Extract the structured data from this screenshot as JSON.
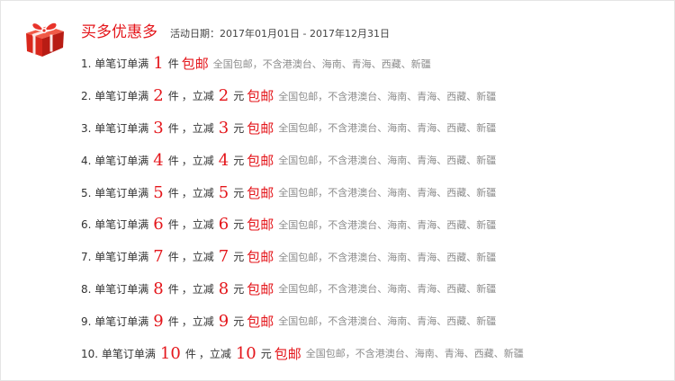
{
  "header": {
    "title": "买多优惠多",
    "date_label": "活动日期：2017年01月01日 - 2017年12月31日"
  },
  "icons": {
    "gift": "gift-box-icon"
  },
  "colors": {
    "accent": "#e4161b",
    "gift_red": "#e8332a",
    "note": "#8c8c8c"
  },
  "rows": [
    {
      "prefix": "1. 单笔订单满",
      "count": "1",
      "unit": "件",
      "has_discount": false,
      "free": "包邮",
      "note": "全国包邮，不含港澳台、海南、青海、西藏、新疆"
    },
    {
      "prefix": "2. 单笔订单满",
      "count": "2",
      "unit": "件",
      "has_discount": true,
      "discount_label": "，立减",
      "discount": "2",
      "discount_unit": "元",
      "free": "包邮",
      "note": "全国包邮，不含港澳台、海南、青海、西藏、新疆"
    },
    {
      "prefix": "3. 单笔订单满",
      "count": "3",
      "unit": "件",
      "has_discount": true,
      "discount_label": "，立减",
      "discount": "3",
      "discount_unit": "元",
      "free": "包邮",
      "note": "全国包邮，不含港澳台、海南、青海、西藏、新疆"
    },
    {
      "prefix": "4. 单笔订单满",
      "count": "4",
      "unit": "件",
      "has_discount": true,
      "discount_label": "，立减",
      "discount": "4",
      "discount_unit": "元",
      "free": "包邮",
      "note": "全国包邮，不含港澳台、海南、青海、西藏、新疆"
    },
    {
      "prefix": "5. 单笔订单满",
      "count": "5",
      "unit": "件",
      "has_discount": true,
      "discount_label": "，立减",
      "discount": "5",
      "discount_unit": "元",
      "free": "包邮",
      "note": "全国包邮，不含港澳台、海南、青海、西藏、新疆"
    },
    {
      "prefix": "6. 单笔订单满",
      "count": "6",
      "unit": "件",
      "has_discount": true,
      "discount_label": "，立减",
      "discount": "6",
      "discount_unit": "元",
      "free": "包邮",
      "note": "全国包邮，不含港澳台、海南、青海、西藏、新疆"
    },
    {
      "prefix": "7. 单笔订单满",
      "count": "7",
      "unit": "件",
      "has_discount": true,
      "discount_label": "，立减",
      "discount": "7",
      "discount_unit": "元",
      "free": "包邮",
      "note": "全国包邮，不含港澳台、海南、青海、西藏、新疆"
    },
    {
      "prefix": "8. 单笔订单满",
      "count": "8",
      "unit": "件",
      "has_discount": true,
      "discount_label": "，立减",
      "discount": "8",
      "discount_unit": "元",
      "free": "包邮",
      "note": "全国包邮，不含港澳台、海南、青海、西藏、新疆"
    },
    {
      "prefix": "9. 单笔订单满",
      "count": "9",
      "unit": "件",
      "has_discount": true,
      "discount_label": "，立减",
      "discount": "9",
      "discount_unit": "元",
      "free": "包邮",
      "note": "全国包邮，不含港澳台、海南、青海、西藏、新疆"
    },
    {
      "prefix": "10. 单笔订单满",
      "count": "10",
      "unit": "件",
      "has_discount": true,
      "discount_label": "，立减",
      "discount": "10",
      "discount_unit": "元",
      "free": "包邮",
      "note": "全国包邮，不含港澳台、海南、青海、西藏、新疆"
    }
  ]
}
